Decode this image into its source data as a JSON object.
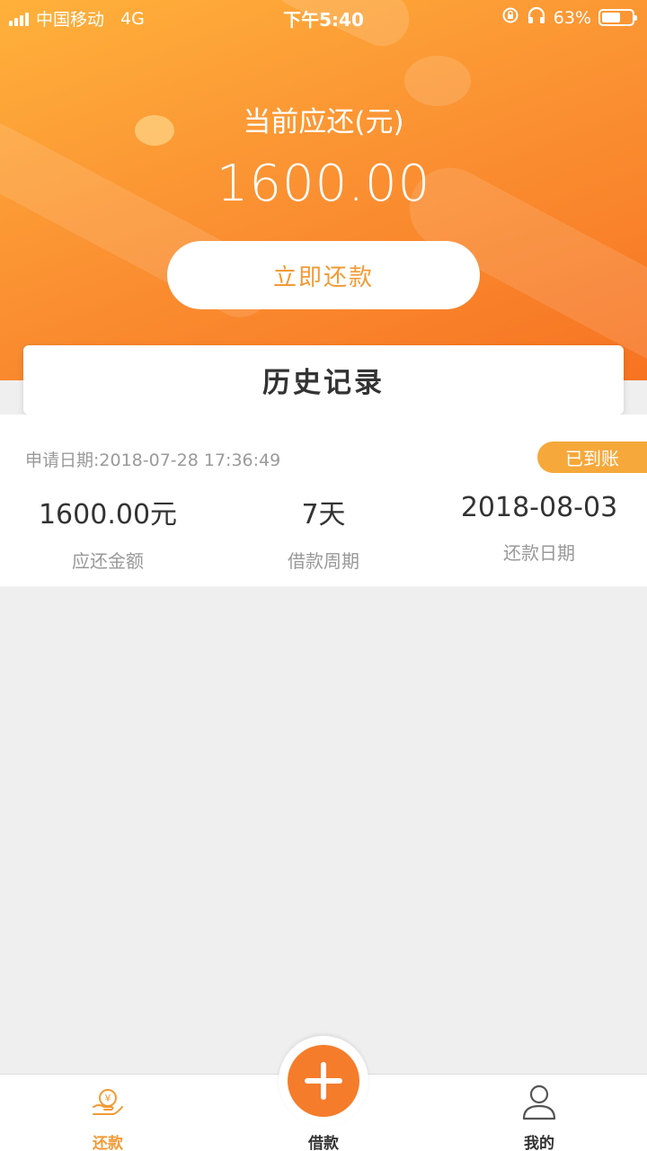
{
  "status_bar": {
    "carrier": "中国移动",
    "network": "4G",
    "time": "下午5:40",
    "battery": "63%",
    "battery_level": 0.63
  },
  "header": {
    "label": "当前应还(元)",
    "amount": "1600.00",
    "pay_button": "立即还款"
  },
  "history": {
    "title": "历史记录"
  },
  "record": {
    "apply_date": "申请日期:2018-07-28 17:36:49",
    "status": "已到账",
    "amount_value": "1600.00元",
    "amount_label": "应还金额",
    "period_value": "7天",
    "period_label": "借款周期",
    "due_value": "2018-08-03",
    "due_label": "还款日期"
  },
  "tabbar": {
    "tabs": [
      {
        "label": "还款",
        "icon": "repay-icon",
        "active": true
      },
      {
        "label": "借款",
        "icon": "plus-icon",
        "active": false
      },
      {
        "label": "我的",
        "icon": "user-icon",
        "active": false
      }
    ]
  },
  "colors": {
    "accent": "#f39a35",
    "badge": "#f7a83a",
    "fab": "#f57c2b"
  }
}
